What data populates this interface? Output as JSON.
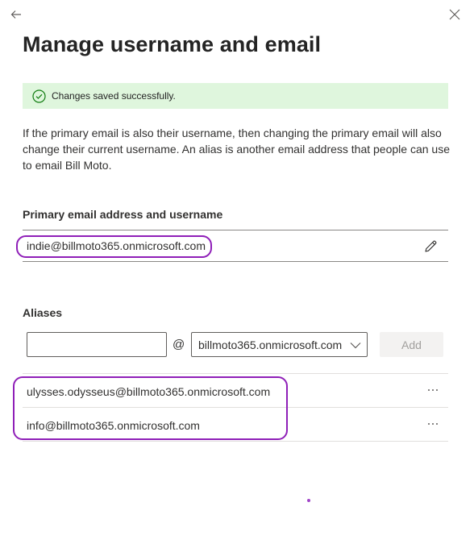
{
  "panel": {
    "title": "Manage username and email",
    "back_icon": "arrow-left-icon",
    "close_icon": "close-icon"
  },
  "notification": {
    "text": "Changes saved successfully.",
    "icon": "checkmark-circle-icon",
    "background": "#dff6dd",
    "accent": "#107c10"
  },
  "description": "If the primary email is also their username, then changing the primary email will also change their current username. An alias is another email address that people can use to email Bill Moto.",
  "primary": {
    "label": "Primary email address and username",
    "email": "indie@billmoto365.onmicrosoft.com",
    "edit_icon": "pencil-icon"
  },
  "aliases": {
    "label": "Aliases",
    "input_value": "",
    "input_placeholder": "",
    "at_symbol": "@",
    "domain_selected": "billmoto365.onmicrosoft.com",
    "add_label": "Add",
    "items": [
      {
        "email": "ulysses.odysseus@billmoto365.onmicrosoft.com",
        "more": "···"
      },
      {
        "email": "info@billmoto365.onmicrosoft.com",
        "more": "···"
      }
    ]
  },
  "annotation_color": "#8f1fb8"
}
